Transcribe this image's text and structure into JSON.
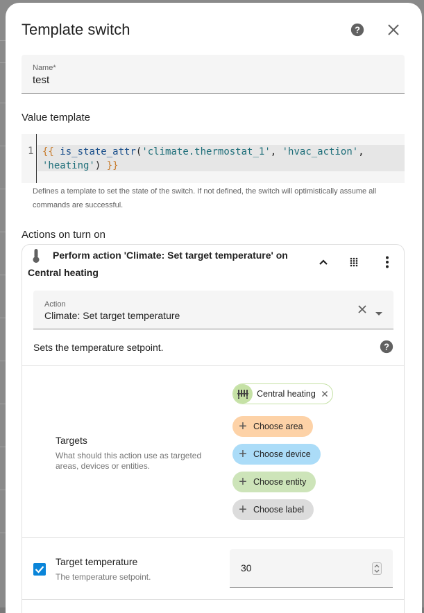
{
  "dialog": {
    "title": "Template switch"
  },
  "name_field": {
    "label": "Name*",
    "value": "test"
  },
  "value_template": {
    "title": "Value template",
    "line_number": "1",
    "code": {
      "open": "{{",
      "fn": "is_state_attr",
      "paren_open": "(",
      "arg1": "'climate.thermostat_1'",
      "comma": ", ",
      "arg2": "'hvac_action'",
      "comma2": ",",
      "arg3": "'heating'",
      "paren_close": ")",
      "close": "}}"
    },
    "helper": "Defines a template to set the state of the switch. If not defined, the switch will optimistically assume all commands are successful."
  },
  "actions_on": {
    "title": "Actions on turn on",
    "card": {
      "header": "Perform action 'Climate: Set target temperature' on Central heating",
      "action_field": {
        "label": "Action",
        "value": "Climate: Set target temperature"
      },
      "description": "Sets the temperature setpoint.",
      "targets": {
        "title": "Targets",
        "description": "What should this action use as targeted areas, devices or entities.",
        "selected_entity": "Central heating",
        "choose_area": "Choose area",
        "choose_device": "Choose device",
        "choose_entity": "Choose entity",
        "choose_label": "Choose label"
      },
      "target_temperature": {
        "title": "Target temperature",
        "description": "The temperature setpoint.",
        "value": "30",
        "checked": true
      }
    }
  },
  "colors": {
    "accent": "#0a85d9",
    "area_chip": "#fdd2a7",
    "device_chip": "#abdcf8",
    "entity_chip": "#cde4b9",
    "label_chip": "#dcdcdc"
  },
  "icons": {
    "help": "help-circle-icon",
    "close": "close-icon",
    "thermometer": "thermometer-icon",
    "collapse": "chevron-up-icon",
    "drag": "drag-handle-icon",
    "menu": "dots-vertical-icon",
    "clear": "clear-icon",
    "dropdown": "menu-down-icon",
    "radiator": "radiator-icon"
  }
}
